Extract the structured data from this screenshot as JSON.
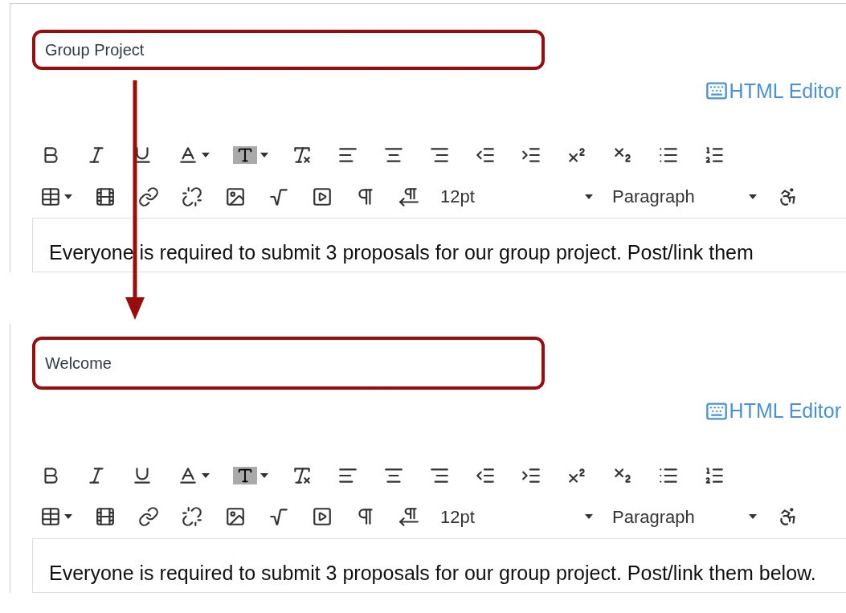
{
  "editors": [
    {
      "title": "Group Project",
      "html_editor_link": "HTML Editor",
      "font_size": "12pt",
      "block_format": "Paragraph",
      "body": "Everyone is required to submit 3 proposals for our group project. Post/link them"
    },
    {
      "title": "Welcome",
      "html_editor_link": "HTML Editor",
      "font_size": "12pt",
      "block_format": "Paragraph",
      "body": "Everyone is required to submit 3 proposals for our group project. Post/link them below."
    }
  ]
}
